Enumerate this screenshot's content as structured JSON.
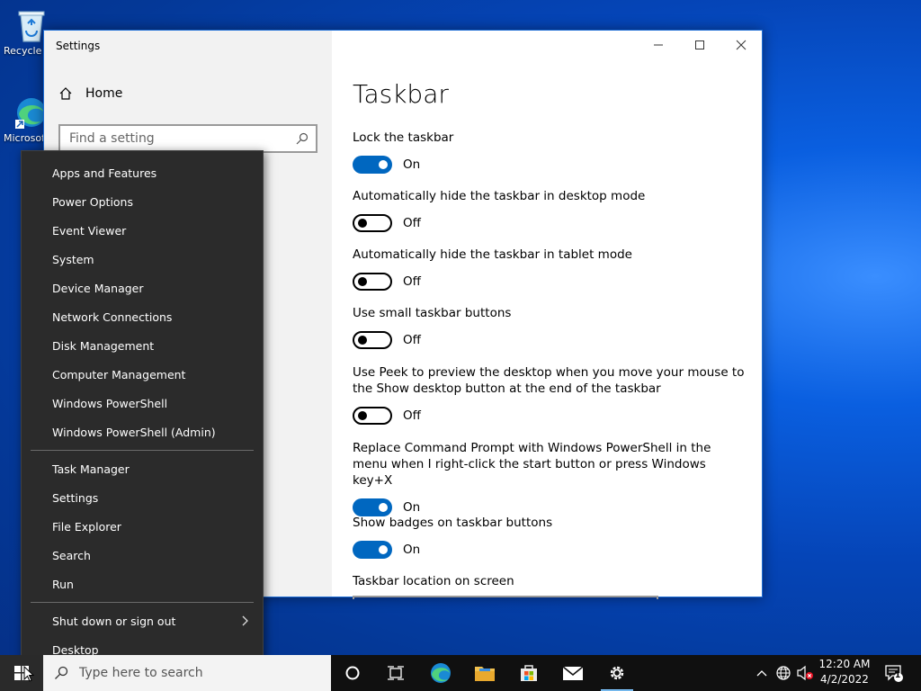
{
  "desktop": {
    "icons": [
      {
        "label": "Recycle Bin",
        "icon": "recycle-bin-icon"
      },
      {
        "label": "Microsoft Edge",
        "icon": "edge-icon"
      }
    ]
  },
  "settings_window": {
    "title": "Settings",
    "home_label": "Home",
    "search_placeholder": "Find a setting",
    "page_title": "Taskbar",
    "settings": [
      {
        "label": "Lock the taskbar",
        "state": "On",
        "on": true
      },
      {
        "label": "Automatically hide the taskbar in desktop mode",
        "state": "Off",
        "on": false
      },
      {
        "label": "Automatically hide the taskbar in tablet mode",
        "state": "Off",
        "on": false
      },
      {
        "label": "Use small taskbar buttons",
        "state": "Off",
        "on": false
      },
      {
        "label": "Use Peek to preview the desktop when you move your mouse to the Show desktop button at the end of the taskbar",
        "state": "Off",
        "on": false
      },
      {
        "label": "Replace Command Prompt with Windows PowerShell in the menu when I right-click the start button or press Windows key+X",
        "state": "On",
        "on": true
      },
      {
        "label": "Show badges on taskbar buttons",
        "state": "On",
        "on": true
      }
    ],
    "taskbar_location_label": "Taskbar location on screen"
  },
  "winx_menu": {
    "group1": [
      "Apps and Features",
      "Power Options",
      "Event Viewer",
      "System",
      "Device Manager",
      "Network Connections",
      "Disk Management",
      "Computer Management",
      "Windows PowerShell",
      "Windows PowerShell (Admin)"
    ],
    "group2": [
      "Task Manager",
      "Settings",
      "File Explorer",
      "Search",
      "Run"
    ],
    "group3": [
      "Shut down or sign out",
      "Desktop"
    ]
  },
  "taskbar": {
    "search_placeholder": "Type here to search",
    "time": "12:20 AM",
    "date": "4/2/2022",
    "notification_count": "1",
    "accent_color": "#0067c0"
  }
}
